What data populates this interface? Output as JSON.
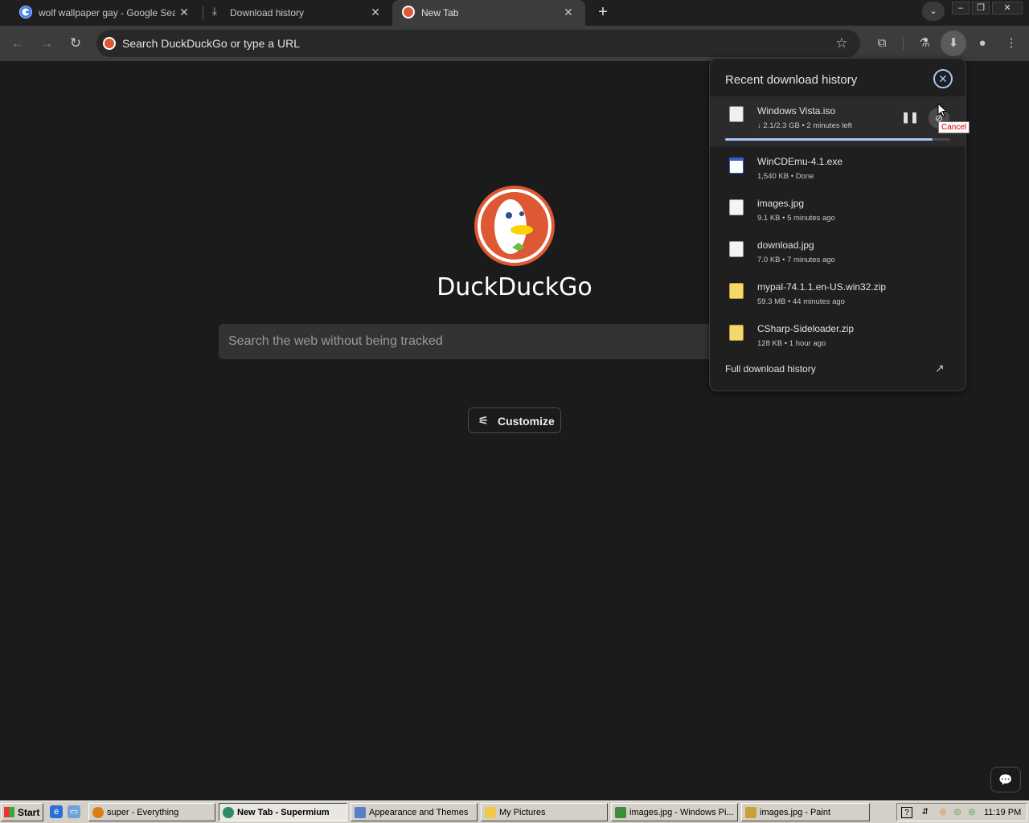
{
  "tabs": [
    {
      "title": "wolf wallpaper gay - Google Search",
      "favicon": "google-icon"
    },
    {
      "title": "Download history",
      "favicon": "download-icon"
    },
    {
      "title": "New Tab",
      "favicon": "duckduckgo-icon",
      "active": true
    }
  ],
  "toolbar": {
    "omnibox_placeholder": "Search DuckDuckGo or type a URL"
  },
  "newtab": {
    "brand": "DuckDuckGo",
    "search_placeholder": "Search the web without being tracked",
    "customize_label": "Customize"
  },
  "downloads": {
    "title": "Recent download history",
    "active": {
      "name": "Windows Vista.iso",
      "status": "↓ 2.1/2.3 GB • 2 minutes left",
      "progress": 0.92
    },
    "cancel_tooltip": "Cancel",
    "items": [
      {
        "name": "WinCDEmu-4.1.exe",
        "status": "1,540 KB • Done",
        "icon": "exe-icon"
      },
      {
        "name": "images.jpg",
        "status": "9.1 KB • 5 minutes ago",
        "icon": "image-file-icon"
      },
      {
        "name": "download.jpg",
        "status": "7.0 KB • 7 minutes ago",
        "icon": "image-file-icon"
      },
      {
        "name": "mypal-74.1.1.en-US.win32.zip",
        "status": "59.3 MB • 44 minutes ago",
        "icon": "zip-folder-icon"
      },
      {
        "name": "CSharp-Sideloader.zip",
        "status": "128 KB • 1 hour ago",
        "icon": "zip-folder-icon"
      }
    ],
    "full_history_label": "Full download history"
  },
  "taskbar": {
    "start_label": "Start",
    "tasks": [
      {
        "label": "super - Everything"
      },
      {
        "label": "New Tab - Supermium",
        "active": true
      },
      {
        "label": "Appearance and Themes"
      },
      {
        "label": "My Pictures"
      },
      {
        "label": "images.jpg - Windows Pi..."
      },
      {
        "label": "images.jpg - Paint"
      }
    ],
    "clock": "11:19 PM"
  },
  "colors": {
    "accent": "#a8c7fa",
    "ddg_orange": "#de5833",
    "background": "#1c1b1c"
  }
}
